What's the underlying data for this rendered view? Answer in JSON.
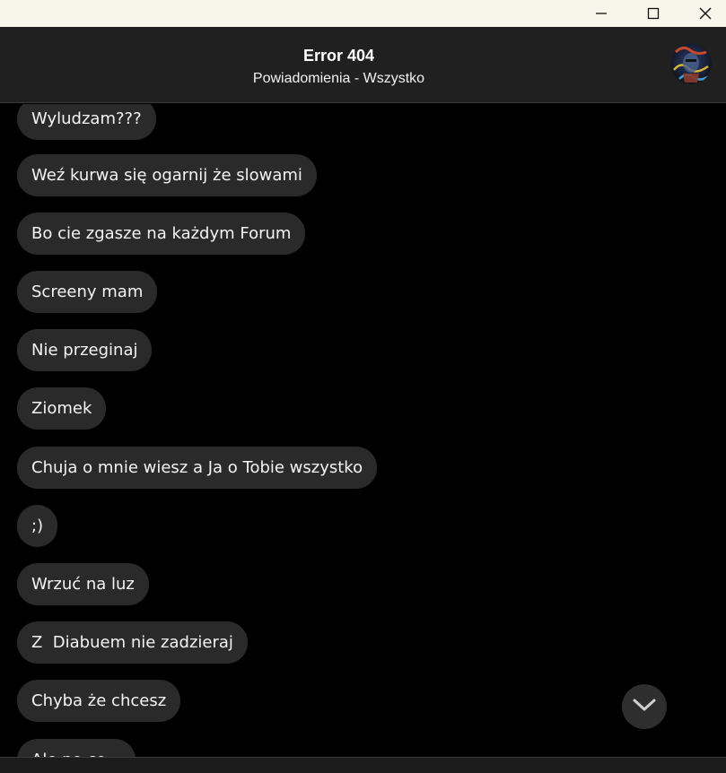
{
  "header": {
    "title": "Error 404",
    "subtitle": "Powiadomienia - Wszystko"
  },
  "window_controls": {
    "minimize_icon": "minimize-icon",
    "maximize_icon": "maximize-icon",
    "close_icon": "close-icon"
  },
  "messages": [
    "Wyludzam???",
    "Weź kurwa się ogarnij że slowami",
    "Bo cie zgasze na każdym Forum",
    "Screeny mam",
    "Nie przeginaj",
    "Ziomek",
    "Chuja o mnie wiesz a Ja o Tobie wszystko",
    ";)",
    "Wrzuć na luz",
    "Z  Diabuem nie zadzieraj",
    "Chyba że chcesz",
    "Ale po co..."
  ],
  "colors": {
    "background": "#000000",
    "bubble": "#2a2a2a",
    "header": "#202020",
    "titlebar": "#f6f6ea"
  },
  "scroll_button_icon": "chevron-down-icon"
}
